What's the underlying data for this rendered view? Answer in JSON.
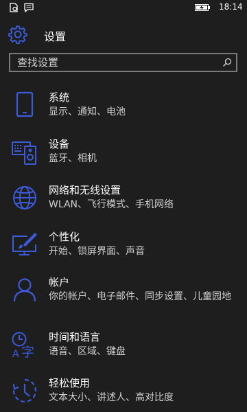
{
  "status_bar": {
    "time": "18:14"
  },
  "header": {
    "title": "设置",
    "icon": "gear-icon"
  },
  "search": {
    "placeholder": "查找设置"
  },
  "colors": {
    "accent": "#3b5bdb",
    "background": "#1e1e1e",
    "subtitle": "#cfcfcf"
  },
  "settings": {
    "items": [
      {
        "title": "系统",
        "subtitle": "显示、通知、电池",
        "icon": "phone-icon"
      },
      {
        "title": "设备",
        "subtitle": "蓝牙、相机",
        "icon": "devices-icon"
      },
      {
        "title": "网络和无线设置",
        "subtitle": "WLAN、飞行模式、手机网络",
        "icon": "globe-icon"
      },
      {
        "title": "个性化",
        "subtitle": "开始、锁屏界面、声音",
        "icon": "personalization-icon"
      },
      {
        "title": "帐户",
        "subtitle": "你的帐户、电子邮件、同步设置、儿童园地",
        "icon": "person-icon"
      },
      {
        "title": "时间和语言",
        "subtitle": "语音、区域、键盘",
        "icon": "time-language-icon"
      },
      {
        "title": "轻松使用",
        "subtitle": "文本大小、讲述人、高对比度",
        "icon": "ease-of-access-icon"
      }
    ]
  }
}
